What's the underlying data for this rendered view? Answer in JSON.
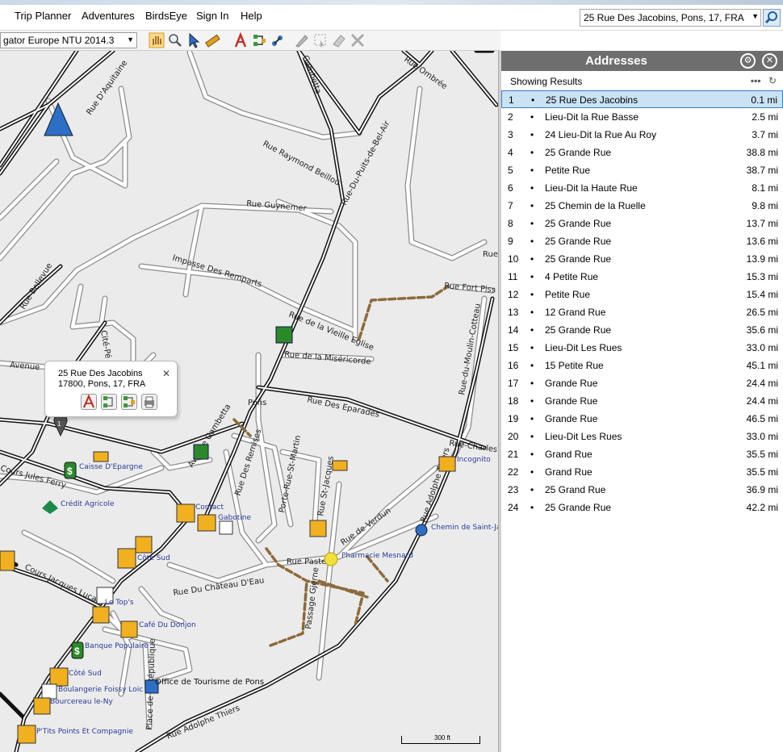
{
  "menu": {
    "items": [
      "Trip Planner",
      "Adventures",
      "BirdsEye",
      "Sign In",
      "Help"
    ]
  },
  "search": {
    "value": "25 Rue Des Jacobins, Pons, 17, FRA"
  },
  "toolbar": {
    "map_product": "gator Europe NTU 2014.3"
  },
  "callout": {
    "line1": "25 Rue Des Jacobins",
    "line2": "17800, Pons, 17, FRA",
    "pin_number": "1"
  },
  "map": {
    "roads": [
      "Rue D'Aquitaine",
      "Gambetta",
      "Rue Raymond Beillou",
      "Rue-Du-Puits-de-Bel-Air",
      "Rue Guynemer",
      "Impasse Des Remparts",
      "Rue-Bellevue",
      "Cité-Pé",
      "Rue de la Vieille Eglise",
      "Rue de la Miséricorde",
      "Rue Fort Piss",
      "Avenue",
      "Pons",
      "Rue Des Eparades",
      "Rue-Charles",
      "Avenue Gambetta",
      "Rue Des Remises",
      "Porte-Rue-St-Martin",
      "Rue St-Jacques",
      "Rue de Verdun",
      "Rue Adolphe Thiers",
      "Rue Pasteur",
      "Rue Du Château D'Eau",
      "Passage Gjerne",
      "Cours Jules Ferry",
      "Cours Jacques Lucas",
      "Place de la République",
      "Rue Adolphe Thiers",
      "Rue-du-Moulin-Cotteau",
      "Rue",
      "Rue Ombrée"
    ],
    "pois": [
      "Caisse D'Epargne",
      "Crédit Agricole",
      "Contact",
      "Gabotine",
      "Côte Sud",
      "Le Top's",
      "Café Du Donjon",
      "Banque Populaire",
      "Côté Sud",
      "Boulangerie Foissy Loic",
      "Bourcereau le-Ny",
      "P'Tits Points Et Compagnie",
      "Office de Tourisme de Pons",
      "Incognito",
      "Chemin de Saint-Ja",
      "Pharmacie Mesnard"
    ],
    "scale": "300 ft"
  },
  "panel": {
    "title": "Addresses",
    "subtitle": "Showing Results",
    "results": [
      {
        "n": "1",
        "name": "25 Rue Des Jacobins",
        "dist": "0.1 mi"
      },
      {
        "n": "2",
        "name": "Lieu-Dit la Rue Basse",
        "dist": "2.5 mi"
      },
      {
        "n": "3",
        "name": "24 Lieu-Dit la Rue Au Roy",
        "dist": "3.7 mi"
      },
      {
        "n": "4",
        "name": "25 Grande Rue",
        "dist": "38.8 mi"
      },
      {
        "n": "5",
        "name": "Petite Rue",
        "dist": "38.7 mi"
      },
      {
        "n": "6",
        "name": "Lieu-Dit la Haute Rue",
        "dist": "8.1 mi"
      },
      {
        "n": "7",
        "name": "25 Chemin de la Ruelle",
        "dist": "9.8 mi"
      },
      {
        "n": "8",
        "name": "25 Grande Rue",
        "dist": "13.7 mi"
      },
      {
        "n": "9",
        "name": "25 Grande Rue",
        "dist": "13.6 mi"
      },
      {
        "n": "10",
        "name": "25 Grande Rue",
        "dist": "13.9 mi"
      },
      {
        "n": "11",
        "name": "4 Petite Rue",
        "dist": "15.3 mi"
      },
      {
        "n": "12",
        "name": "Petite Rue",
        "dist": "15.4 mi"
      },
      {
        "n": "13",
        "name": "12 Grand Rue",
        "dist": "26.5 mi"
      },
      {
        "n": "14",
        "name": "25 Grande Rue",
        "dist": "35.6 mi"
      },
      {
        "n": "15",
        "name": "Lieu-Dit Les Rues",
        "dist": "33.0 mi"
      },
      {
        "n": "16",
        "name": "15 Petite Rue",
        "dist": "45.1 mi"
      },
      {
        "n": "17",
        "name": "Grande Rue",
        "dist": "24.4 mi"
      },
      {
        "n": "18",
        "name": "Grande Rue",
        "dist": "24.4 mi"
      },
      {
        "n": "19",
        "name": "Grande Rue",
        "dist": "46.5 mi"
      },
      {
        "n": "20",
        "name": "Lieu-Dit Les Rues",
        "dist": "33.0 mi"
      },
      {
        "n": "21",
        "name": "Grand Rue",
        "dist": "35.5 mi"
      },
      {
        "n": "22",
        "name": "Grand Rue",
        "dist": "35.5 mi"
      },
      {
        "n": "23",
        "name": "25 Grand Rue",
        "dist": "36.9 mi"
      },
      {
        "n": "24",
        "name": "25 Grande Rue",
        "dist": "42.2 mi"
      }
    ]
  },
  "icons": {
    "search": "search-icon",
    "settings": "gear-icon",
    "close": "close-icon",
    "refresh": "refresh-icon",
    "more": "more-icon"
  }
}
